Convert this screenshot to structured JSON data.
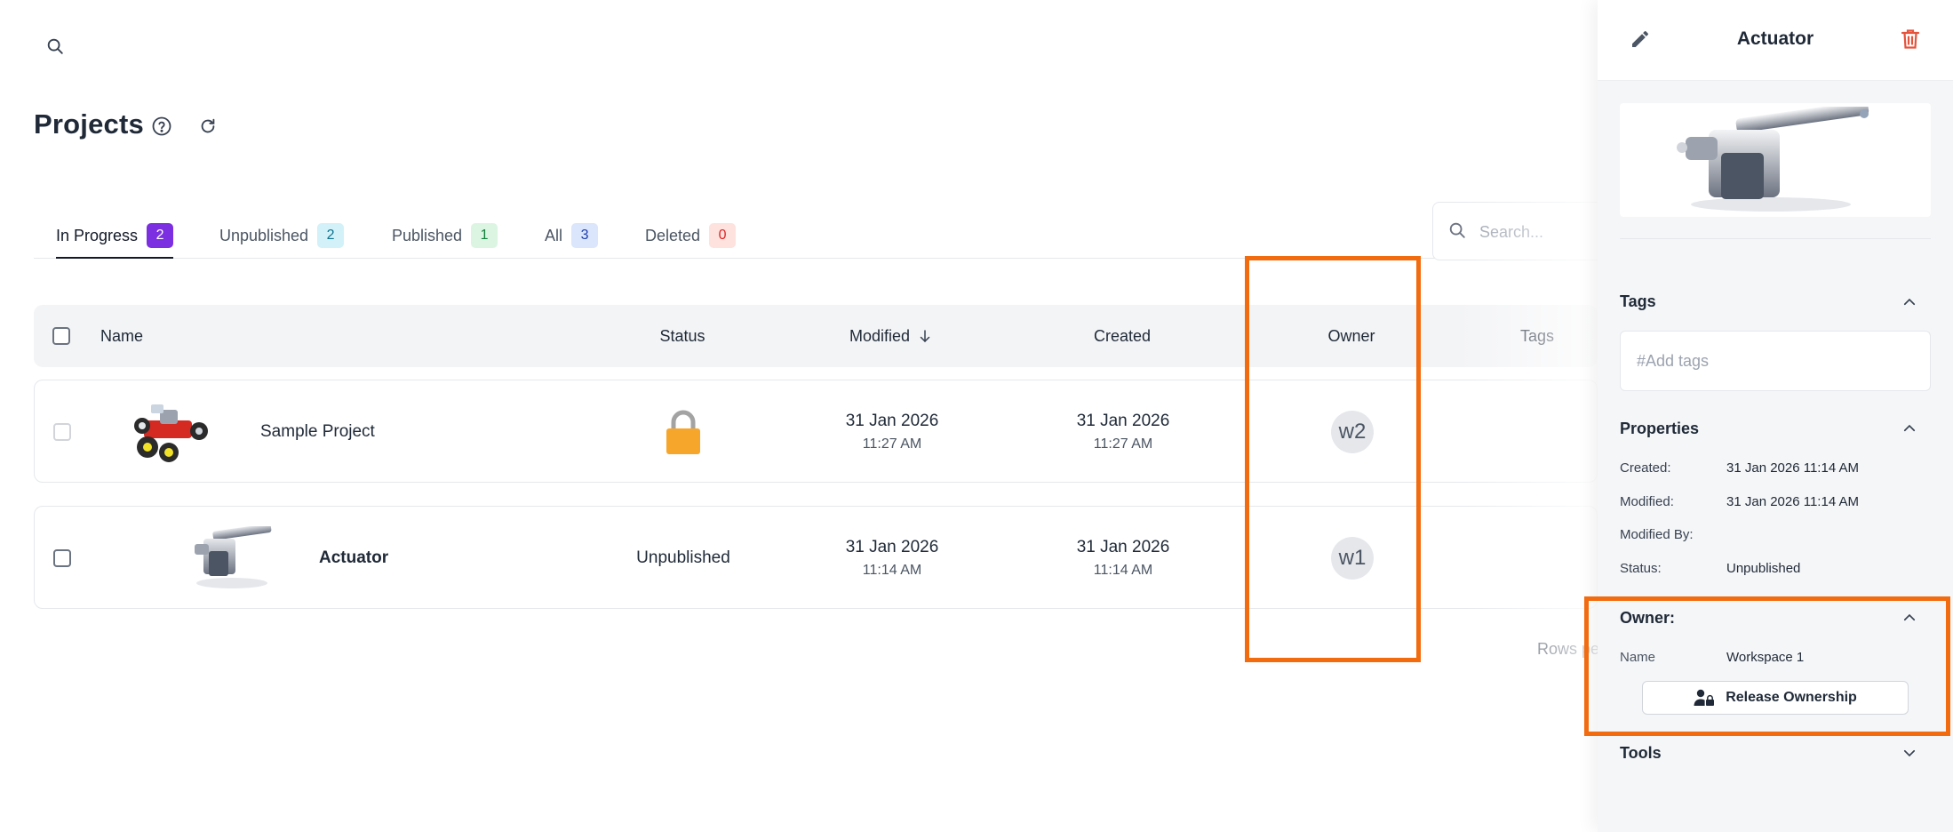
{
  "header": {
    "title": "Projects"
  },
  "tabs": [
    {
      "label": "In Progress",
      "count": "2",
      "active": true,
      "badge_bg": "#7c2fe0",
      "badge_fg": "#ffffff"
    },
    {
      "label": "Unpublished",
      "count": "2",
      "active": false,
      "badge_bg": "#d3f1f8",
      "badge_fg": "#0e7490"
    },
    {
      "label": "Published",
      "count": "1",
      "active": false,
      "badge_bg": "#dcf5e3",
      "badge_fg": "#15803d"
    },
    {
      "label": "All",
      "count": "3",
      "active": false,
      "badge_bg": "#dbe5fb",
      "badge_fg": "#1e40af"
    },
    {
      "label": "Deleted",
      "count": "0",
      "active": false,
      "badge_bg": "#fde2de",
      "badge_fg": "#dc2626"
    }
  ],
  "search": {
    "placeholder": "Search..."
  },
  "table": {
    "columns": {
      "name": "Name",
      "status": "Status",
      "modified": "Modified",
      "created": "Created",
      "owner": "Owner",
      "tags": "Tags"
    },
    "rows": [
      {
        "name": "Sample Project",
        "status": "",
        "status_icon": "lock-icon",
        "modified_date": "31 Jan 2026",
        "modified_time": "11:27 AM",
        "created_date": "31 Jan 2026",
        "created_time": "11:27 AM",
        "owner": "w2"
      },
      {
        "name": "Actuator",
        "status": "Unpublished",
        "modified_date": "31 Jan 2026",
        "modified_time": "11:14 AM",
        "created_date": "31 Jan 2026",
        "created_time": "11:14 AM",
        "owner": "w1"
      }
    ],
    "rows_per_page_label": "Rows pe"
  },
  "panel": {
    "title": "Actuator",
    "tags_title": "Tags",
    "tags_placeholder": "#Add tags",
    "properties_title": "Properties",
    "properties": [
      {
        "label": "Created:",
        "value": "31 Jan 2026 11:14 AM"
      },
      {
        "label": "Modified:",
        "value": "31 Jan 2026 11:14 AM"
      },
      {
        "label": "Modified By:",
        "value": ""
      },
      {
        "label": "Status:",
        "value": "Unpublished"
      }
    ],
    "owner_title": "Owner:",
    "owner_name_label": "Name",
    "owner_name_value": "Workspace 1",
    "release_button": "Release Ownership",
    "tools_title": "Tools"
  },
  "colors": {
    "highlight": "#f26b0f",
    "lock": "#f7a62c",
    "delete_icon": "#e5533d"
  }
}
